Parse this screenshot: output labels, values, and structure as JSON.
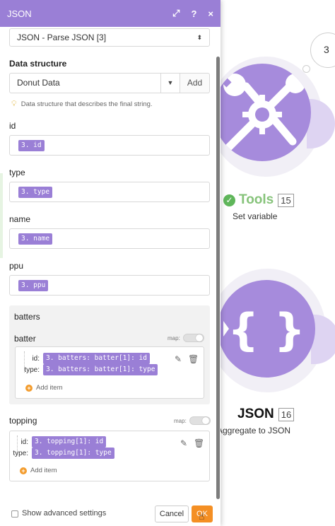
{
  "canvas": {
    "bubble_count": "3",
    "tools": {
      "title": "Tools",
      "number": "15",
      "subtitle": "Set variable"
    },
    "json": {
      "icon_text": "{ }",
      "title": "JSON",
      "number": "16",
      "subtitle": "Aggregate to JSON"
    },
    "colors": {
      "node_purple": "#a68bdc",
      "success_green": "#5fb65a"
    }
  },
  "panel": {
    "title": "JSON",
    "header_icons": [
      "expand-icon",
      "help-icon",
      "close-icon"
    ],
    "module_select": "JSON - Parse JSON [3]",
    "data_structure": {
      "label": "Data structure",
      "value": "Donut Data",
      "add_label": "Add",
      "hint": "Data structure that describes the final string."
    },
    "fields": {
      "id": {
        "label": "id",
        "value": "3. id"
      },
      "type": {
        "label": "type",
        "value": "3. type"
      },
      "name": {
        "label": "name",
        "value": "3. name"
      },
      "ppu": {
        "label": "ppu",
        "value": "3. ppu"
      }
    },
    "batters": {
      "label": "batters",
      "batter_label": "batter",
      "map_label": "map:",
      "id_key": "id:",
      "id_value": "3. batters: batter[1]: id",
      "type_key": "type:",
      "type_value": "3. batters: batter[1]: type",
      "add_item": "Add item"
    },
    "topping": {
      "label": "topping",
      "map_label": "map:",
      "id_key": "id:",
      "id_value": "3. topping[1]: id",
      "type_key": "type:",
      "type_value": "3. topping[1]: type",
      "add_item": "Add item"
    },
    "footer": {
      "advanced_label": "Show advanced settings",
      "cancel_label": "Cancel",
      "ok_label": "OK"
    },
    "colors": {
      "header": "#9a7fd6",
      "pill": "#9a7fd6",
      "ok_button": "#f48f24"
    }
  }
}
